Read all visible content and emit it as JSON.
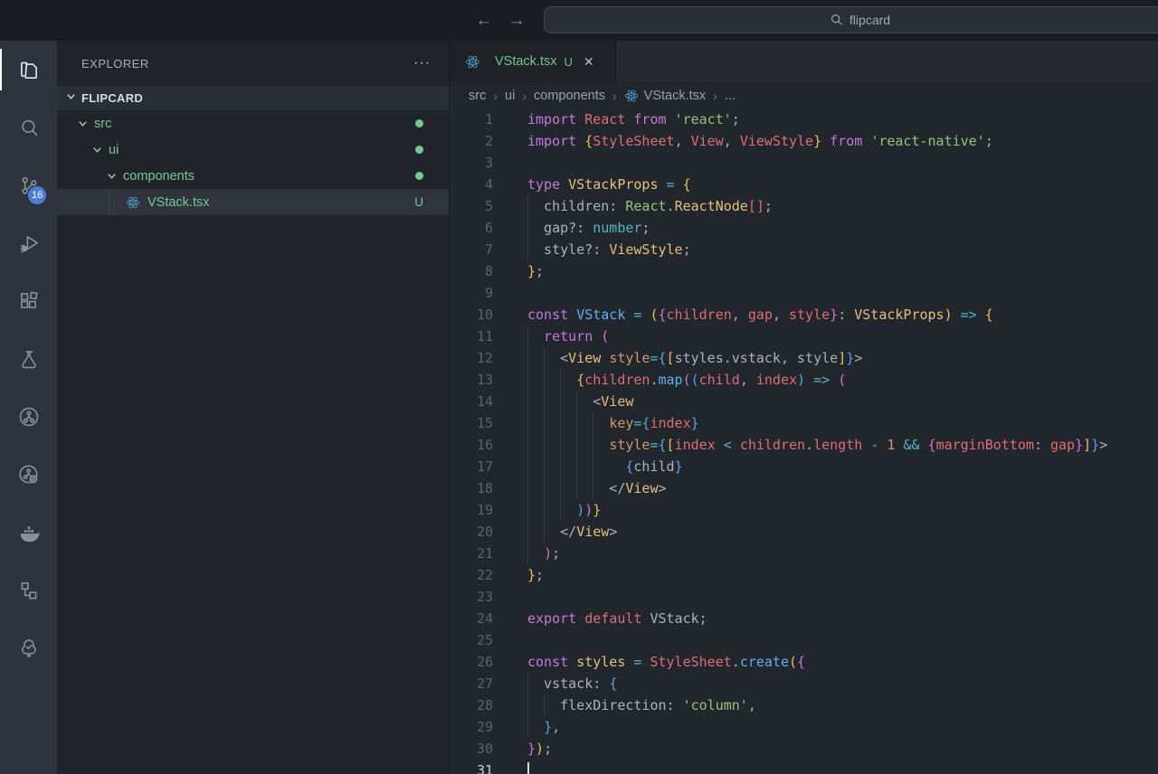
{
  "colors": {
    "accent_green": "#73c991",
    "react_blue": "#53a6dd",
    "badge_blue": "#4a7fd4",
    "syntax": {
      "kw": "#c678dd",
      "red": "#e06c75",
      "str": "#98c379",
      "yel": "#e5c07b",
      "cyn": "#56b6c2",
      "blu": "#61afef",
      "org": "#d19a66",
      "wht": "#abb2bf",
      "b1": "#e8c155",
      "b2": "#d670d6",
      "b3": "#5ba2e8"
    }
  },
  "titlebar": {
    "back": "←",
    "forward": "→",
    "search_text": "flipcard"
  },
  "activity_bar": {
    "items": [
      {
        "name": "explorer",
        "active": true
      },
      {
        "name": "search"
      },
      {
        "name": "source-control",
        "badge": "16"
      },
      {
        "name": "run-debug"
      },
      {
        "name": "extensions"
      },
      {
        "name": "testing"
      },
      {
        "name": "gitlens"
      },
      {
        "name": "gitlens-inspect"
      },
      {
        "name": "docker"
      },
      {
        "name": "hierarchy"
      },
      {
        "name": "todo-tree"
      }
    ]
  },
  "explorer": {
    "title": "EXPLORER",
    "ellipsis": "···",
    "section": "FLIPCARD",
    "tree": [
      {
        "label": "src",
        "type": "folder",
        "indent": 0,
        "badge": "dot"
      },
      {
        "label": "ui",
        "type": "folder",
        "indent": 1,
        "badge": "dot"
      },
      {
        "label": "components",
        "type": "folder",
        "indent": 2,
        "badge": "dot"
      },
      {
        "label": "VStack.tsx",
        "type": "file-react",
        "indent": 3,
        "badge": "U",
        "selected": true
      }
    ]
  },
  "editor": {
    "tab": {
      "label": "VStack.tsx",
      "dirty": "U",
      "close": "✕"
    },
    "breadcrumbs": [
      {
        "label": "src"
      },
      {
        "label": "ui"
      },
      {
        "label": "components"
      },
      {
        "label": "VStack.tsx",
        "icon": "react"
      },
      {
        "label": "..."
      }
    ],
    "code": {
      "active_line": 31,
      "lines": [
        {
          "n": 1,
          "tokens": [
            [
              "kw",
              "import"
            ],
            [
              "wht",
              " "
            ],
            [
              "red",
              "React"
            ],
            [
              "kw",
              " from "
            ],
            [
              "str",
              "'react'"
            ],
            [
              "wht",
              ";"
            ]
          ]
        },
        {
          "n": 2,
          "tokens": [
            [
              "kw",
              "import"
            ],
            [
              "wht",
              " "
            ],
            [
              "b1",
              "{"
            ],
            [
              "red",
              "StyleSheet"
            ],
            [
              "wht",
              ", "
            ],
            [
              "red",
              "View"
            ],
            [
              "wht",
              ", "
            ],
            [
              "red",
              "ViewStyle"
            ],
            [
              "b1",
              "}"
            ],
            [
              "kw",
              " from "
            ],
            [
              "str",
              "'react-native'"
            ],
            [
              "wht",
              ";"
            ]
          ]
        },
        {
          "n": 3,
          "tokens": []
        },
        {
          "n": 4,
          "tokens": [
            [
              "kw",
              "type"
            ],
            [
              "wht",
              " "
            ],
            [
              "yel",
              "VStackProps"
            ],
            [
              "wht",
              " "
            ],
            [
              "cyn",
              "="
            ],
            [
              "wht",
              " "
            ],
            [
              "b1",
              "{"
            ]
          ]
        },
        {
          "n": 5,
          "guides": 1,
          "tokens": [
            [
              "wht",
              "  children: "
            ],
            [
              "str",
              "React"
            ],
            [
              "wht",
              "."
            ],
            [
              "yel",
              "ReactNode"
            ],
            [
              "red",
              "[]"
            ],
            [
              "wht",
              ";"
            ]
          ]
        },
        {
          "n": 6,
          "guides": 1,
          "tokens": [
            [
              "wht",
              "  gap?: "
            ],
            [
              "cyn",
              "number"
            ],
            [
              "wht",
              ";"
            ]
          ]
        },
        {
          "n": 7,
          "guides": 1,
          "tokens": [
            [
              "wht",
              "  style?: "
            ],
            [
              "yel",
              "ViewStyle"
            ],
            [
              "wht",
              ";"
            ]
          ]
        },
        {
          "n": 8,
          "tokens": [
            [
              "b1",
              "}"
            ],
            [
              "wht",
              ";"
            ]
          ]
        },
        {
          "n": 9,
          "tokens": []
        },
        {
          "n": 10,
          "tokens": [
            [
              "kw",
              "const"
            ],
            [
              "wht",
              " "
            ],
            [
              "blu",
              "VStack"
            ],
            [
              "wht",
              " "
            ],
            [
              "cyn",
              "="
            ],
            [
              "wht",
              " "
            ],
            [
              "b1",
              "("
            ],
            [
              "b2",
              "{"
            ],
            [
              "red",
              "children"
            ],
            [
              "wht",
              ", "
            ],
            [
              "red",
              "gap"
            ],
            [
              "wht",
              ", "
            ],
            [
              "red",
              "style"
            ],
            [
              "b2",
              "}"
            ],
            [
              "wht",
              ": "
            ],
            [
              "yel",
              "VStackProps"
            ],
            [
              "b1",
              ")"
            ],
            [
              "wht",
              " "
            ],
            [
              "cyn",
              "=>"
            ],
            [
              "wht",
              " "
            ],
            [
              "b1",
              "{"
            ]
          ]
        },
        {
          "n": 11,
          "guides": 1,
          "tokens": [
            [
              "kw",
              "  return"
            ],
            [
              "wht",
              " "
            ],
            [
              "b2",
              "("
            ]
          ]
        },
        {
          "n": 12,
          "guides": 2,
          "tokens": [
            [
              "wht",
              "    <"
            ],
            [
              "yel",
              "View"
            ],
            [
              "wht",
              " "
            ],
            [
              "org",
              "style"
            ],
            [
              "cyn",
              "="
            ],
            [
              "b3",
              "{"
            ],
            [
              "b1",
              "["
            ],
            [
              "wht",
              "styles.vstack, style"
            ],
            [
              "b1",
              "]"
            ],
            [
              "b3",
              "}"
            ],
            [
              "wht",
              ">"
            ]
          ]
        },
        {
          "n": 13,
          "guides": 3,
          "tokens": [
            [
              "wht",
              "      "
            ],
            [
              "b1",
              "{"
            ],
            [
              "red",
              "children"
            ],
            [
              "wht",
              "."
            ],
            [
              "blu",
              "map"
            ],
            [
              "b2",
              "("
            ],
            [
              "b3",
              "("
            ],
            [
              "red",
              "child"
            ],
            [
              "wht",
              ", "
            ],
            [
              "red",
              "index"
            ],
            [
              "b3",
              ")"
            ],
            [
              "wht",
              " "
            ],
            [
              "cyn",
              "=>"
            ],
            [
              "wht",
              " "
            ],
            [
              "b2",
              "("
            ]
          ]
        },
        {
          "n": 14,
          "guides": 4,
          "tokens": [
            [
              "wht",
              "        <"
            ],
            [
              "yel",
              "View"
            ]
          ]
        },
        {
          "n": 15,
          "guides": 5,
          "tokens": [
            [
              "wht",
              "          "
            ],
            [
              "org",
              "key"
            ],
            [
              "cyn",
              "="
            ],
            [
              "b3",
              "{"
            ],
            [
              "red",
              "index"
            ],
            [
              "b3",
              "}"
            ]
          ]
        },
        {
          "n": 16,
          "guides": 5,
          "tokens": [
            [
              "wht",
              "          "
            ],
            [
              "org",
              "style"
            ],
            [
              "cyn",
              "="
            ],
            [
              "b3",
              "{"
            ],
            [
              "b1",
              "["
            ],
            [
              "red",
              "index"
            ],
            [
              "wht",
              " "
            ],
            [
              "cyn",
              "<"
            ],
            [
              "wht",
              " "
            ],
            [
              "red",
              "children"
            ],
            [
              "wht",
              "."
            ],
            [
              "red",
              "length"
            ],
            [
              "wht",
              " "
            ],
            [
              "cyn",
              "-"
            ],
            [
              "wht",
              " "
            ],
            [
              "org",
              "1"
            ],
            [
              "wht",
              " "
            ],
            [
              "cyn",
              "&&"
            ],
            [
              "wht",
              " "
            ],
            [
              "b2",
              "{"
            ],
            [
              "red",
              "marginBottom"
            ],
            [
              "wht",
              ": "
            ],
            [
              "red",
              "gap"
            ],
            [
              "b2",
              "}"
            ],
            [
              "b1",
              "]"
            ],
            [
              "b3",
              "}"
            ],
            [
              "wht",
              ">"
            ]
          ]
        },
        {
          "n": 17,
          "guides": 5,
          "tokens": [
            [
              "wht",
              "            "
            ],
            [
              "b3",
              "{"
            ],
            [
              "wht",
              "child"
            ],
            [
              "b3",
              "}"
            ]
          ]
        },
        {
          "n": 18,
          "guides": 5,
          "tokens": [
            [
              "wht",
              "          </"
            ],
            [
              "yel",
              "View"
            ],
            [
              "wht",
              ">"
            ]
          ]
        },
        {
          "n": 19,
          "guides": 3,
          "tokens": [
            [
              "wht",
              "      "
            ],
            [
              "b3",
              ")"
            ],
            [
              "b2",
              ")"
            ],
            [
              "b1",
              "}"
            ]
          ]
        },
        {
          "n": 20,
          "guides": 2,
          "tokens": [
            [
              "wht",
              "    </"
            ],
            [
              "yel",
              "View"
            ],
            [
              "wht",
              ">"
            ]
          ]
        },
        {
          "n": 21,
          "guides": 1,
          "tokens": [
            [
              "wht",
              "  "
            ],
            [
              "b2",
              ")"
            ],
            [
              "wht",
              ";"
            ]
          ]
        },
        {
          "n": 22,
          "tokens": [
            [
              "b1",
              "}"
            ],
            [
              "wht",
              ";"
            ]
          ]
        },
        {
          "n": 23,
          "tokens": []
        },
        {
          "n": 24,
          "tokens": [
            [
              "kw",
              "export"
            ],
            [
              "wht",
              " "
            ],
            [
              "red",
              "default"
            ],
            [
              "wht",
              " VStack;"
            ]
          ]
        },
        {
          "n": 25,
          "tokens": []
        },
        {
          "n": 26,
          "tokens": [
            [
              "kw",
              "const"
            ],
            [
              "wht",
              " "
            ],
            [
              "yel",
              "styles"
            ],
            [
              "wht",
              " "
            ],
            [
              "cyn",
              "="
            ],
            [
              "wht",
              " "
            ],
            [
              "red",
              "StyleSheet"
            ],
            [
              "wht",
              "."
            ],
            [
              "blu",
              "create"
            ],
            [
              "b1",
              "("
            ],
            [
              "b2",
              "{"
            ]
          ]
        },
        {
          "n": 27,
          "guides": 1,
          "tokens": [
            [
              "wht",
              "  vstack: "
            ],
            [
              "b3",
              "{"
            ]
          ]
        },
        {
          "n": 28,
          "guides": 2,
          "tokens": [
            [
              "wht",
              "    flexDirection: "
            ],
            [
              "str",
              "'column'"
            ],
            [
              "wht",
              ","
            ]
          ]
        },
        {
          "n": 29,
          "guides": 1,
          "tokens": [
            [
              "wht",
              "  "
            ],
            [
              "b3",
              "}"
            ],
            [
              "wht",
              ","
            ]
          ]
        },
        {
          "n": 30,
          "tokens": [
            [
              "b2",
              "}"
            ],
            [
              "b1",
              ")"
            ],
            [
              "wht",
              ";"
            ]
          ]
        },
        {
          "n": 31,
          "cursor": true,
          "tokens": []
        }
      ]
    }
  }
}
